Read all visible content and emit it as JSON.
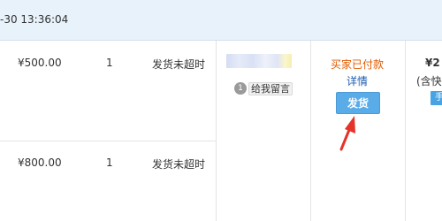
{
  "order": {
    "time": "-30 13:36:04",
    "rows": [
      {
        "price": "¥500.00",
        "qty": "1",
        "status": "发货未超时"
      },
      {
        "price": "¥800.00",
        "qty": "1",
        "status": "发货未超时"
      }
    ]
  },
  "buyer": {
    "message_count": "1",
    "message_label": "给我留言"
  },
  "trade": {
    "status": "买家已付款",
    "detail_label": "详情",
    "ship_label": "发货"
  },
  "payment": {
    "amount": "¥2",
    "includes": "(含快",
    "tag": "手"
  },
  "colors": {
    "header_bg": "#e8f2fb",
    "paid_status": "#e25a00",
    "link": "#1c5db1",
    "ship_button": "#5aace9",
    "arrow": "#e5332a"
  }
}
